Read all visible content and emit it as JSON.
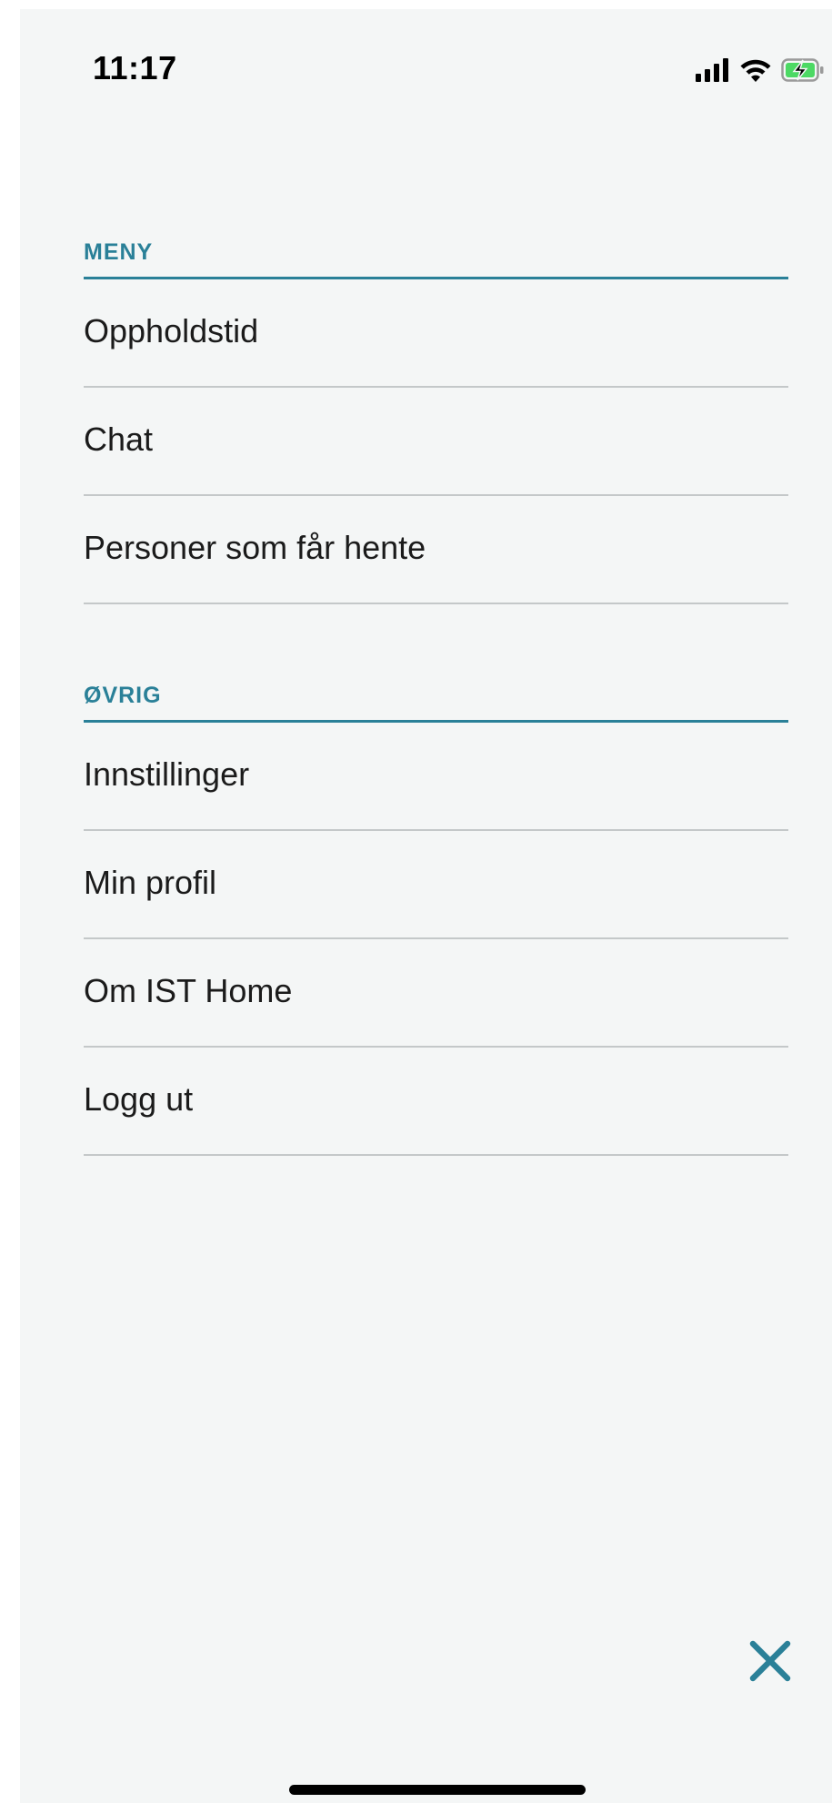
{
  "status_bar": {
    "time": "11:17",
    "icons": [
      "cellular-signal-icon",
      "wifi-icon",
      "battery-charging-icon"
    ]
  },
  "sections": [
    {
      "title": "MENY",
      "items": [
        "Oppholdstid",
        "Chat",
        "Personer som får hente"
      ]
    },
    {
      "title": "ØVRIG",
      "items": [
        "Innstillinger",
        "Min profil",
        "Om IST Home",
        "Logg ut"
      ]
    }
  ],
  "close_icon": "close-icon",
  "colors": {
    "accent": "#2a8098",
    "background": "#f4f6f6",
    "divider": "#c4c8c9",
    "text": "#1b1b1b",
    "battery": "#4cd964"
  }
}
